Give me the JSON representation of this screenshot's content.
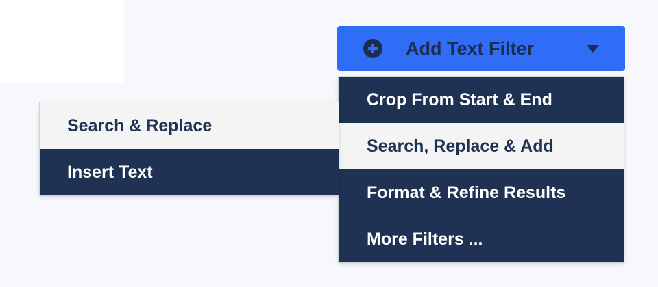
{
  "button": {
    "label": "Add Text Filter",
    "icon": "plus-circle-icon",
    "caret_icon": "caret-down-icon",
    "color": "#2f6df6"
  },
  "main_menu": {
    "items": [
      {
        "label": "Crop From Start & End",
        "highlighted": false
      },
      {
        "label": "Search, Replace & Add",
        "highlighted": true
      },
      {
        "label": "Format & Refine Results",
        "highlighted": false
      },
      {
        "label": "More Filters ...",
        "highlighted": false
      }
    ]
  },
  "sub_menu": {
    "items": [
      {
        "label": "Search & Replace",
        "highlighted": true
      },
      {
        "label": "Insert Text",
        "highlighted": false
      }
    ]
  },
  "colors": {
    "menu_bg": "#1f3253",
    "highlight_bg": "#f4f4f5",
    "text_dark": "#1c2e4f",
    "page_bg": "#f7f8fc"
  }
}
